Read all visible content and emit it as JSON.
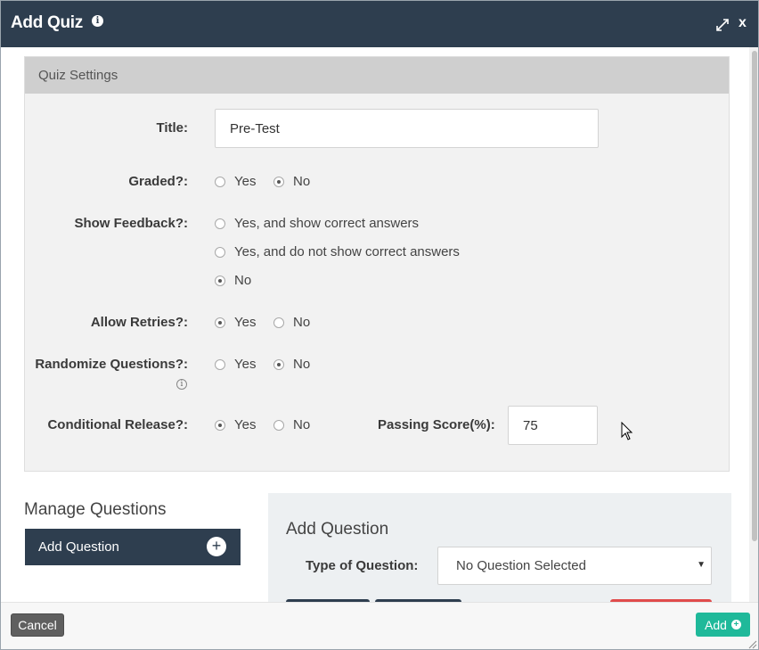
{
  "dialog": {
    "title": "Add Quiz",
    "info_icon": "info-circle-icon",
    "expand_icon": "expand-arrows-icon",
    "close_label": "x"
  },
  "quiz_settings": {
    "header": "Quiz Settings",
    "title_label": "Title:",
    "title_value": "Pre-Test",
    "graded": {
      "label": "Graded?:",
      "options": [
        "Yes",
        "No"
      ],
      "selected": "No"
    },
    "show_feedback": {
      "label": "Show Feedback?:",
      "options": [
        "Yes, and show correct answers",
        "Yes, and do not show correct answers",
        "No"
      ],
      "selected": "No"
    },
    "allow_retries": {
      "label": "Allow Retries?:",
      "options": [
        "Yes",
        "No"
      ],
      "selected": "Yes"
    },
    "randomize_questions": {
      "label": "Randomize Questions?:",
      "options": [
        "Yes",
        "No"
      ],
      "selected": "No"
    },
    "conditional_release": {
      "label": "Conditional Release?:",
      "options": [
        "Yes",
        "No"
      ],
      "selected": "Yes"
    },
    "passing_score_label": "Passing Score(%):",
    "passing_score_value": "75"
  },
  "manage_questions": {
    "title": "Manage Questions",
    "add_button": "Add Question",
    "add_icon": "plus-circle-icon"
  },
  "add_question": {
    "title": "Add Question",
    "type_label": "Type of Question:",
    "type_selected": "No Question Selected"
  },
  "footer": {
    "cancel": "Cancel",
    "add": "Add"
  },
  "colors": {
    "titlebar": "#2e3e4f",
    "add_button": "#1fb99a",
    "cancel_button": "#5f5f5f"
  }
}
